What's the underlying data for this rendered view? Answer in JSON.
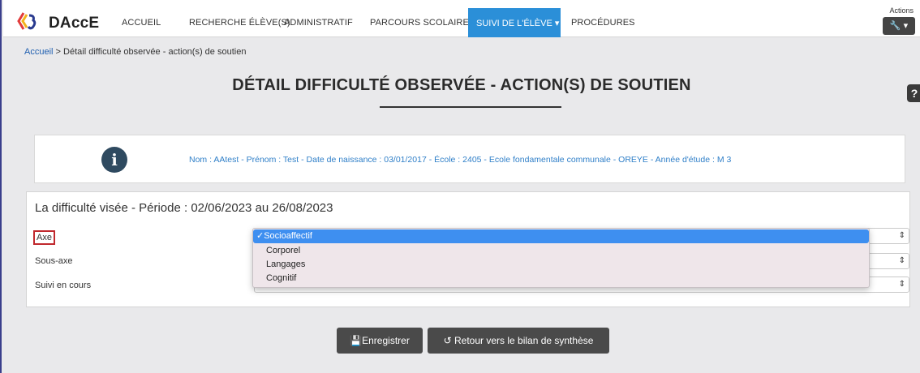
{
  "navbar": {
    "brand": "DAccE",
    "items": [
      "ACCUEIL",
      "RECHERCHE ÉLÈVE(S)",
      "ADMINISTRATIF",
      "PARCOURS SCOLAIRE"
    ],
    "active": "SUIVI DE L'ÉLÈVE",
    "active_caret": "▾",
    "last_item": "PROCÉDURES",
    "actions_label": "Actions",
    "actions_icon": "wrench-icon",
    "actions_caret": "▾"
  },
  "breadcrumb": {
    "home": "Accueil",
    "separator": ">",
    "current": "Détail difficulté observée - action(s) de soutien"
  },
  "page_title": "DÉTAIL DIFFICULTÉ OBSERVÉE - ACTION(S) DE SOUTIEN",
  "help": "?",
  "info": {
    "icon": "info-icon",
    "text": "Nom : AAtest - Prénom : Test - Date de naissance : 03/01/2017 - École : 2405 - Ecole fondamentale communale - OREYE - Année d'étude : M 3"
  },
  "form": {
    "section_title": "La difficulté visée - Période : 02/06/2023 au 26/08/2023",
    "fields": [
      {
        "label": "Axe"
      },
      {
        "label": "Sous-axe"
      },
      {
        "label": "Suivi en cours"
      }
    ],
    "dropdown": {
      "checkmark": "✓",
      "options": [
        "Socioaffectif",
        "Corporel",
        "Langages",
        "Cognitif"
      ],
      "selected": "Socioaffectif"
    }
  },
  "buttons": {
    "save": "Enregistrer",
    "back": "Retour vers le bilan de synthèse"
  },
  "colors": {
    "nav_active": "#2b8fd8",
    "info_text": "#2f7fc8",
    "highlight_border": "#c0282d",
    "dropdown_selected": "#3e8ff0",
    "button": "#4a4a4a"
  }
}
